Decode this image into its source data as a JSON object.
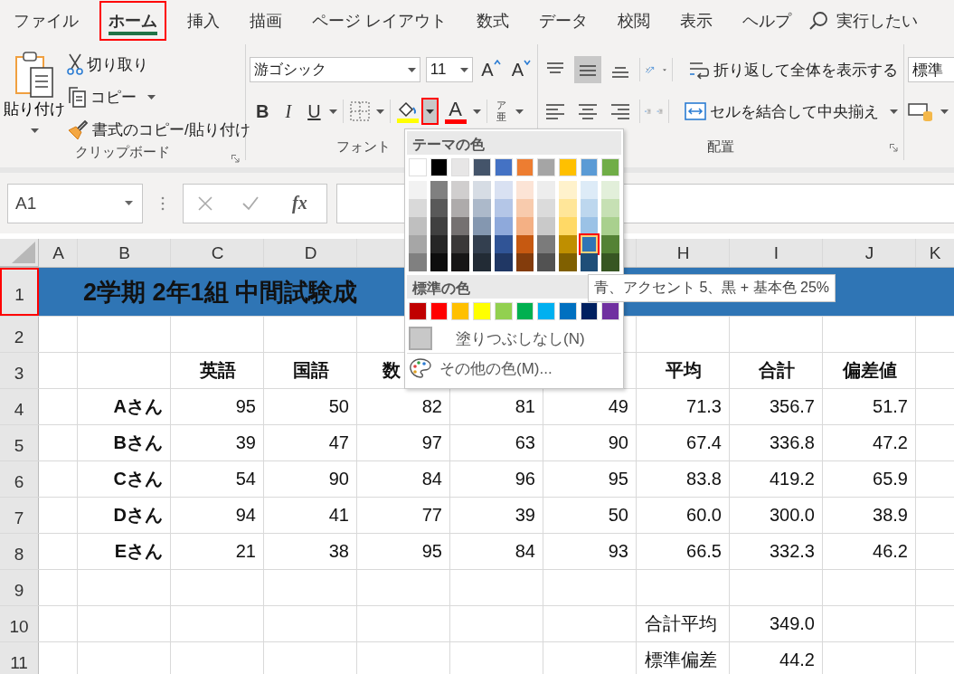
{
  "tabs": [
    {
      "label": "ファイル",
      "selected": false,
      "annotated": false
    },
    {
      "label": "ホーム",
      "selected": true,
      "annotated": true
    },
    {
      "label": "挿入",
      "selected": false,
      "annotated": false
    },
    {
      "label": "描画",
      "selected": false,
      "annotated": false
    },
    {
      "label": "ページ レイアウト",
      "selected": false,
      "annotated": false
    },
    {
      "label": "数式",
      "selected": false,
      "annotated": false
    },
    {
      "label": "データ",
      "selected": false,
      "annotated": false
    },
    {
      "label": "校閲",
      "selected": false,
      "annotated": false
    },
    {
      "label": "表示",
      "selected": false,
      "annotated": false
    },
    {
      "label": "ヘルプ",
      "selected": false,
      "annotated": false
    }
  ],
  "search": {
    "placeholder": "実行したい"
  },
  "ribbon": {
    "clipboard": {
      "paste": "貼り付け",
      "cut": "切り取り",
      "copy": "コピー",
      "format_painter": "書式のコピー/貼り付け",
      "label": "クリップボード"
    },
    "font": {
      "font_name": "游ゴシック",
      "font_size": "11",
      "grow": "A",
      "shrink": "A",
      "bold": "B",
      "italic": "I",
      "underline": "U",
      "fill": {
        "color": "#ffff00",
        "annotated": true
      },
      "font_color": {
        "letter": "A",
        "color": "#ff0000"
      },
      "phonetic_top": "ア",
      "phonetic_bottom": "亜",
      "label": "フォント"
    },
    "alignment": {
      "vertical": [
        {
          "kind": "top",
          "selected": false
        },
        {
          "kind": "middle",
          "selected": true
        },
        {
          "kind": "bottom",
          "selected": false
        }
      ],
      "horizontal": [
        {
          "kind": "left",
          "selected": false
        },
        {
          "kind": "center",
          "selected": false
        },
        {
          "kind": "right",
          "selected": false
        }
      ],
      "wrap_text": "折り返して全体を表示する",
      "merge": "セルを結合して中央揃え",
      "label": "配置"
    },
    "number": {
      "format": "標準"
    }
  },
  "formula_bar": {
    "name_box": "A1",
    "function": "fx"
  },
  "sheet": {
    "columns": [
      "A",
      "B",
      "C",
      "D",
      null,
      null,
      null,
      "H",
      "I",
      "J",
      "K"
    ],
    "rows": [
      {
        "header": "1",
        "annotated": true,
        "kind": "title",
        "title": "2学期 2年1組 中間試験成",
        "color": "#2f75b5"
      },
      {
        "header": "2",
        "annotated": false,
        "kind": "blank"
      },
      {
        "header": "3",
        "annotated": false,
        "kind": "header",
        "cells": [
          null,
          null,
          "英語",
          "国語",
          "数",
          null,
          null,
          "平均",
          "合計",
          "偏差値",
          null
        ]
      },
      {
        "header": "4",
        "annotated": false,
        "kind": "data",
        "cells": [
          null,
          "Aさん",
          "95",
          "50",
          "82",
          "81",
          "49",
          "71.3",
          "356.7",
          "51.7",
          null
        ]
      },
      {
        "header": "5",
        "annotated": false,
        "kind": "data",
        "cells": [
          null,
          "Bさん",
          "39",
          "47",
          "97",
          "63",
          "90",
          "67.4",
          "336.8",
          "47.2",
          null
        ]
      },
      {
        "header": "6",
        "annotated": false,
        "kind": "data",
        "cells": [
          null,
          "Cさん",
          "54",
          "90",
          "84",
          "96",
          "95",
          "83.8",
          "419.2",
          "65.9",
          null
        ]
      },
      {
        "header": "7",
        "annotated": false,
        "kind": "data",
        "cells": [
          null,
          "Dさん",
          "94",
          "41",
          "77",
          "39",
          "50",
          "60.0",
          "300.0",
          "38.9",
          null
        ]
      },
      {
        "header": "8",
        "annotated": false,
        "kind": "data",
        "cells": [
          null,
          "Eさん",
          "21",
          "38",
          "95",
          "84",
          "93",
          "66.5",
          "332.3",
          "46.2",
          null
        ]
      },
      {
        "header": "9",
        "annotated": false,
        "kind": "blank"
      },
      {
        "header": "10",
        "annotated": false,
        "kind": "summary",
        "cells": [
          null,
          null,
          null,
          null,
          null,
          null,
          null,
          "合計平均",
          "349.0",
          null,
          null
        ]
      },
      {
        "header": "11",
        "annotated": false,
        "kind": "summary",
        "cells": [
          null,
          null,
          null,
          null,
          null,
          null,
          null,
          "標準偏差",
          "44.2",
          null,
          null
        ]
      }
    ]
  },
  "color_picker": {
    "theme_title": "テーマの色",
    "theme_colors": [
      {
        "color": "#ffffff",
        "selected": false,
        "shades": [
          {
            "color": "#f2f2f2",
            "selected": false
          },
          {
            "color": "#d9d9d9",
            "selected": false
          },
          {
            "color": "#bfbfbf",
            "selected": false
          },
          {
            "color": "#a6a6a6",
            "selected": false
          },
          {
            "color": "#808080",
            "selected": false
          }
        ]
      },
      {
        "color": "#000000",
        "selected": false,
        "shades": [
          {
            "color": "#808080",
            "selected": false
          },
          {
            "color": "#595959",
            "selected": false
          },
          {
            "color": "#404040",
            "selected": false
          },
          {
            "color": "#262626",
            "selected": false
          },
          {
            "color": "#0d0d0d",
            "selected": false
          }
        ]
      },
      {
        "color": "#e7e6e6",
        "selected": false,
        "shades": [
          {
            "color": "#d0cece",
            "selected": false
          },
          {
            "color": "#aeabab",
            "selected": false
          },
          {
            "color": "#757171",
            "selected": false
          },
          {
            "color": "#3a3838",
            "selected": false
          },
          {
            "color": "#171616",
            "selected": false
          }
        ]
      },
      {
        "color": "#44546a",
        "selected": false,
        "shades": [
          {
            "color": "#d6dce4",
            "selected": false
          },
          {
            "color": "#acb9ca",
            "selected": false
          },
          {
            "color": "#8497b0",
            "selected": false
          },
          {
            "color": "#333f4f",
            "selected": false
          },
          {
            "color": "#222b35",
            "selected": false
          }
        ]
      },
      {
        "color": "#4472c4",
        "selected": false,
        "shades": [
          {
            "color": "#d9e1f2",
            "selected": false
          },
          {
            "color": "#b4c6e7",
            "selected": false
          },
          {
            "color": "#8ea9db",
            "selected": false
          },
          {
            "color": "#305496",
            "selected": false
          },
          {
            "color": "#203764",
            "selected": false
          }
        ]
      },
      {
        "color": "#ed7d31",
        "selected": false,
        "shades": [
          {
            "color": "#fce4d6",
            "selected": false
          },
          {
            "color": "#f8cbad",
            "selected": false
          },
          {
            "color": "#f4b084",
            "selected": false
          },
          {
            "color": "#c65911",
            "selected": false
          },
          {
            "color": "#833c0c",
            "selected": false
          }
        ]
      },
      {
        "color": "#a5a5a5",
        "selected": false,
        "shades": [
          {
            "color": "#ededed",
            "selected": false
          },
          {
            "color": "#dbdbdb",
            "selected": false
          },
          {
            "color": "#c9c9c9",
            "selected": false
          },
          {
            "color": "#7b7b7b",
            "selected": false
          },
          {
            "color": "#525252",
            "selected": false
          }
        ]
      },
      {
        "color": "#ffc000",
        "selected": false,
        "shades": [
          {
            "color": "#fff2cc",
            "selected": false
          },
          {
            "color": "#ffe699",
            "selected": false
          },
          {
            "color": "#ffd966",
            "selected": false
          },
          {
            "color": "#bf8f00",
            "selected": false
          },
          {
            "color": "#806000",
            "selected": false
          }
        ]
      },
      {
        "color": "#5b9bd5",
        "selected": false,
        "shades": [
          {
            "color": "#ddebf7",
            "selected": false
          },
          {
            "color": "#bdd7ee",
            "selected": false
          },
          {
            "color": "#9bc2e6",
            "selected": false
          },
          {
            "color": "#2f75b5",
            "selected": true
          },
          {
            "color": "#1f4e78",
            "selected": false
          }
        ]
      },
      {
        "color": "#70ad47",
        "selected": false,
        "shades": [
          {
            "color": "#e2efda",
            "selected": false
          },
          {
            "color": "#c6e0b4",
            "selected": false
          },
          {
            "color": "#a9d08e",
            "selected": false
          },
          {
            "color": "#548235",
            "selected": false
          },
          {
            "color": "#375623",
            "selected": false
          }
        ]
      }
    ],
    "standard_title": "標準の色",
    "standard_colors": [
      {
        "color": "#c00000",
        "selected": false
      },
      {
        "color": "#ff0000",
        "selected": false
      },
      {
        "color": "#ffc000",
        "selected": false
      },
      {
        "color": "#ffff00",
        "selected": false
      },
      {
        "color": "#92d050",
        "selected": false
      },
      {
        "color": "#00b050",
        "selected": false
      },
      {
        "color": "#00b0f0",
        "selected": false
      },
      {
        "color": "#0070c0",
        "selected": false
      },
      {
        "color": "#002060",
        "selected": false
      },
      {
        "color": "#7030a0",
        "selected": false
      }
    ],
    "no_fill": "塗りつぶしなし(N)",
    "more_colors": "その他の色(M)...",
    "tooltip": "青、アクセント 5、黒 + 基本色 25%"
  }
}
